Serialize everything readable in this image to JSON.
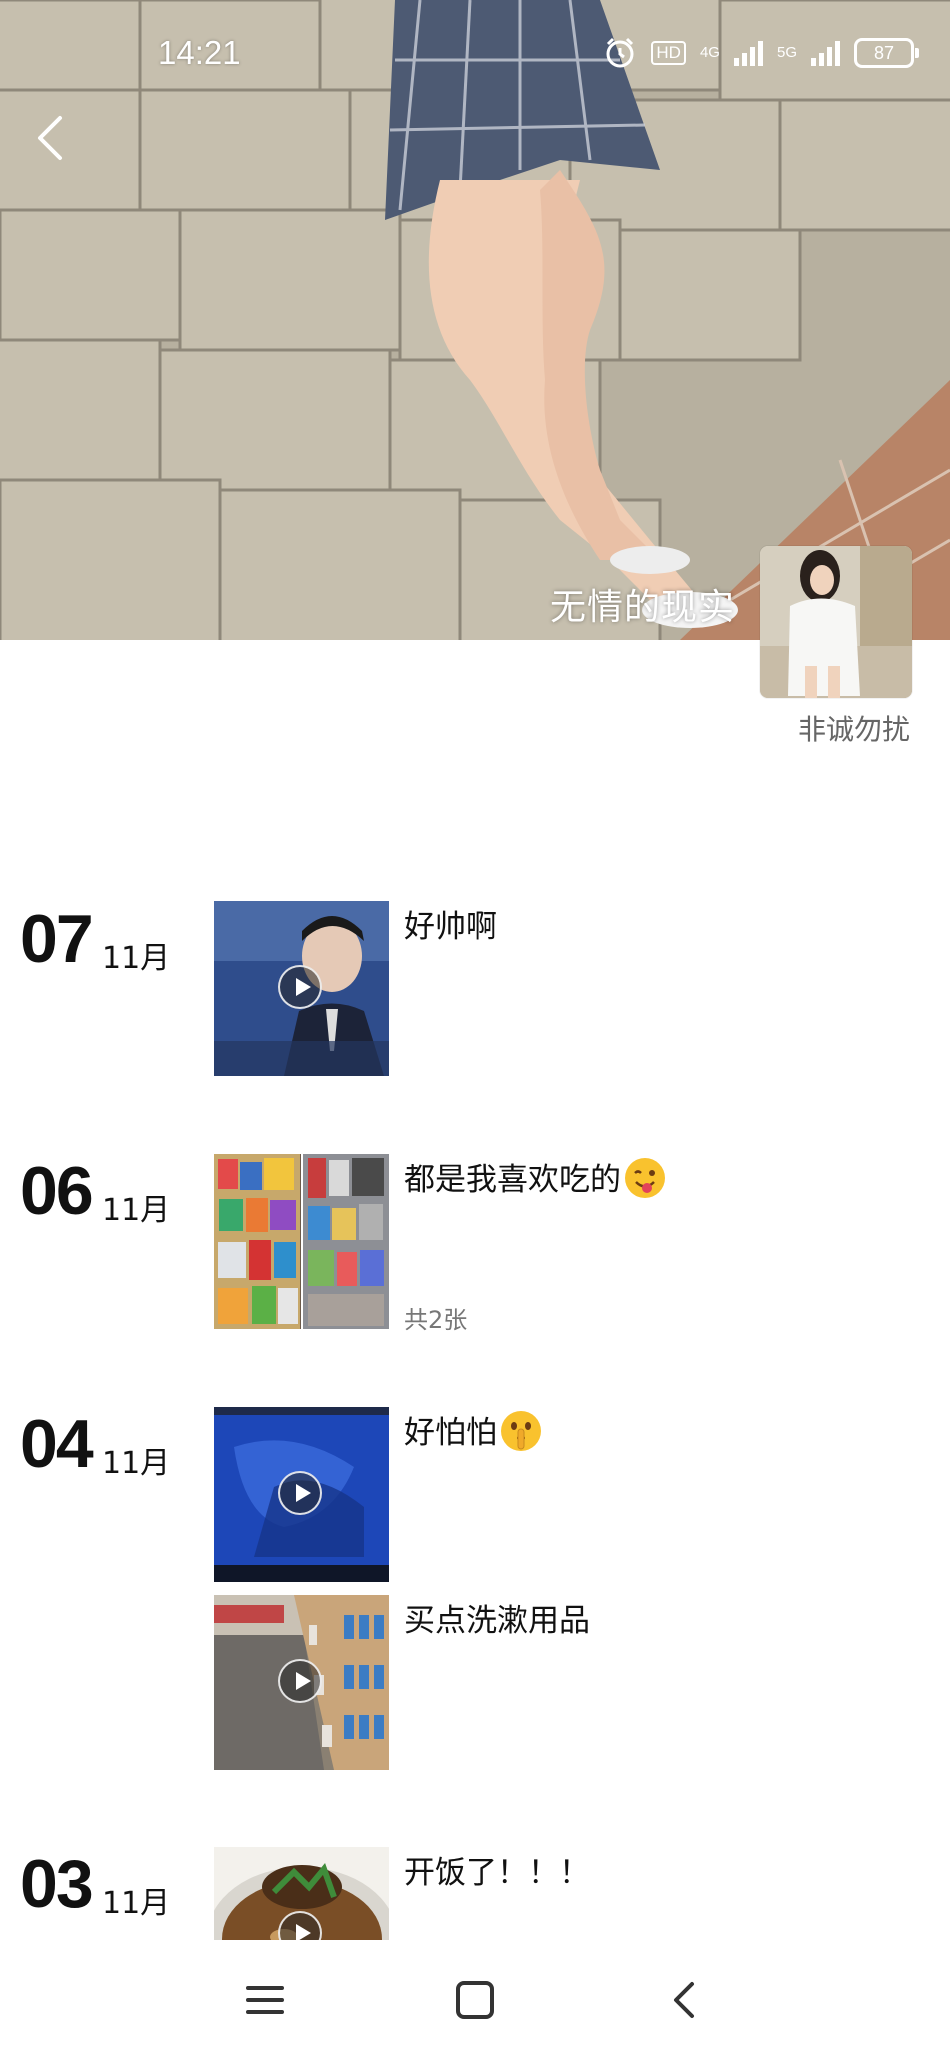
{
  "status_bar": {
    "time": "14:21",
    "hd": "HD",
    "net1": "4G",
    "net2": "5G",
    "battery": "87"
  },
  "cover": {
    "caption": "无情的现实"
  },
  "profile": {
    "username": "非诚勿扰"
  },
  "posts_by_day": [
    {
      "day": "07",
      "month": "11月",
      "posts": [
        {
          "text": "好帅啊",
          "type": "video",
          "thumb_color": "#2f4d8c"
        }
      ]
    },
    {
      "day": "06",
      "month": "11月",
      "posts": [
        {
          "text": "都是我喜欢吃的",
          "emoji": "winking-face-tongue-icon",
          "type": "images",
          "count_text": "共2张"
        }
      ]
    },
    {
      "day": "04",
      "month": "11月",
      "posts": [
        {
          "text": "好怕怕",
          "emoji": "shushing-face-icon",
          "type": "video",
          "thumb_color": "#1c3e8a"
        },
        {
          "text": "买点洗漱用品",
          "type": "video",
          "thumb_color": "#8a8072"
        }
      ]
    },
    {
      "day": "03",
      "month": "11月",
      "posts": [
        {
          "text": "开饭了！！！",
          "type": "video",
          "thumb_color": "#5a3b24"
        }
      ]
    }
  ],
  "nav": {
    "menu": "menu-icon",
    "home": "home-icon",
    "back": "back-icon"
  }
}
